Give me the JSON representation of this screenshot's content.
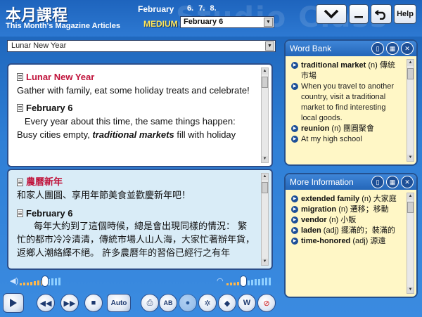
{
  "header": {
    "title_zh": "本月課程",
    "subtitle": "This Month's Magazine Articles",
    "month": "February",
    "day_links": "6. 7. 8.",
    "level": "MEDIUM",
    "day_select": "February 6",
    "watermark": "Studio Class",
    "help_label": "Help"
  },
  "article_select": "Lunar New Year",
  "english_pane": {
    "title": "Lunar New Year",
    "intro": "Gather with family, eat some holiday treats and celebrate!",
    "date": "February 6",
    "body_pre": "Every year about this time, the same things happen: Busy cities empty, ",
    "body_em": "traditional markets",
    "body_post": " fill with holiday"
  },
  "chinese_pane": {
    "title": "農曆新年",
    "intro": "和家人團圓、享用年節美食並歡慶新年吧！",
    "date": "February 6",
    "body": "每年大約到了這個時候，總是會出現同樣的情況： 繁忙的都市冷冷清清，傳統市場人山人海，大家忙著辦年貨，返鄉人潮絡繹不絕。 許多農曆年的習俗已經行之有年"
  },
  "word_bank": {
    "title": "Word Bank",
    "entries": [
      {
        "word": "traditional market",
        "pos": "(n)",
        "zh": "傳統市場",
        "example": "When you travel to another country, visit a traditional market to find interesting local goods."
      },
      {
        "word": "reunion",
        "pos": "(n)",
        "zh": "團圓聚會",
        "example": "At my high school"
      }
    ]
  },
  "more_info": {
    "title": "More Information",
    "entries": [
      {
        "word": "extended family",
        "pos": "(n)",
        "zh": "大家庭"
      },
      {
        "word": "migration",
        "pos": "(n)",
        "zh": "遷移；移動"
      },
      {
        "word": "vendor",
        "pos": "(n)",
        "zh": "小販"
      },
      {
        "word": "laden",
        "pos": "(adj)",
        "zh": "擺滿的；裝滿的"
      },
      {
        "word": "time-honored",
        "pos": "(adj)",
        "zh": "源遠"
      }
    ]
  },
  "controls": {
    "auto_label": "Auto",
    "volume_level": 0.55,
    "speed_level": 0.3
  },
  "colors": {
    "title_red": "#c0123a",
    "level_yellow": "#ffe75a",
    "panel_yellow": "#fff7c6",
    "zh_pane_blue": "#d9ecf7"
  }
}
